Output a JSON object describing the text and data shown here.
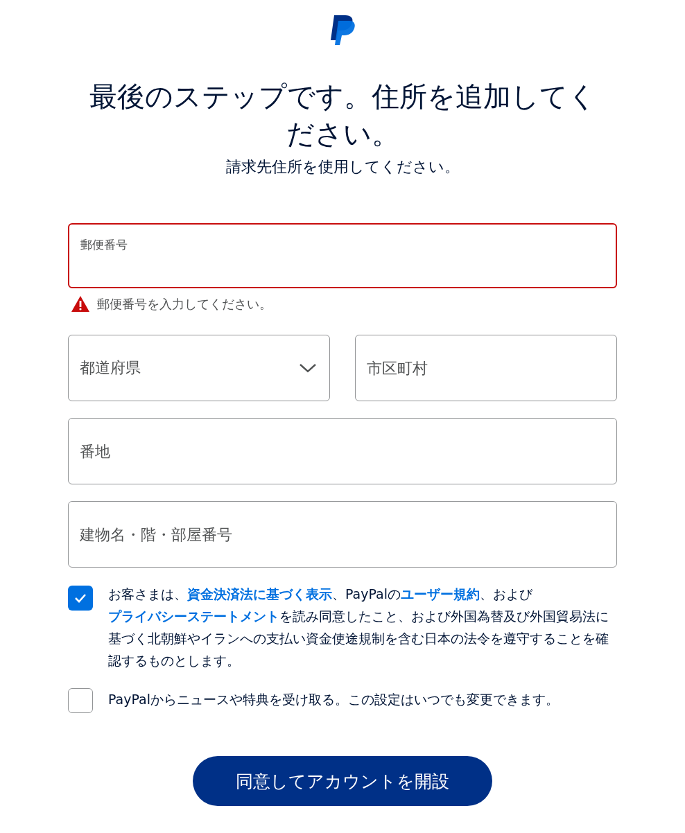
{
  "title": "最後のステップです。住所を追加してください。",
  "subtitle": "請求先住所を使用してください。",
  "postal": {
    "label": "郵便番号",
    "invalid": true,
    "error_message": "郵便番号を入力してください。"
  },
  "prefecture": {
    "placeholder": "都道府県"
  },
  "city": {
    "placeholder": "市区町村"
  },
  "street": {
    "placeholder": "番地"
  },
  "building": {
    "placeholder": "建物名・階・部屋番号"
  },
  "agreements": [
    {
      "checked": true,
      "segments": [
        {
          "text": "お客さまは、",
          "link": false
        },
        {
          "text": "資金決済法に基づく表示",
          "link": true
        },
        {
          "text": "、PayPalの",
          "link": false
        },
        {
          "text": "ユーザー規約",
          "link": true
        },
        {
          "text": "、および",
          "link": false
        },
        {
          "text": "プライバシーステートメント",
          "link": true
        },
        {
          "text": "を読み同意したこと、および外国為替及び外国貿易法に基づく北朝鮮やイランへの支払い資金使途規制を含む日本の法令を遵守することを確認するものとします。",
          "link": false
        }
      ]
    },
    {
      "checked": false,
      "segments": [
        {
          "text": "PayPalからニュースや特典を受け取る。この設定はいつでも変更できます。",
          "link": false
        }
      ]
    }
  ],
  "submit": "同意してアカウントを開設"
}
